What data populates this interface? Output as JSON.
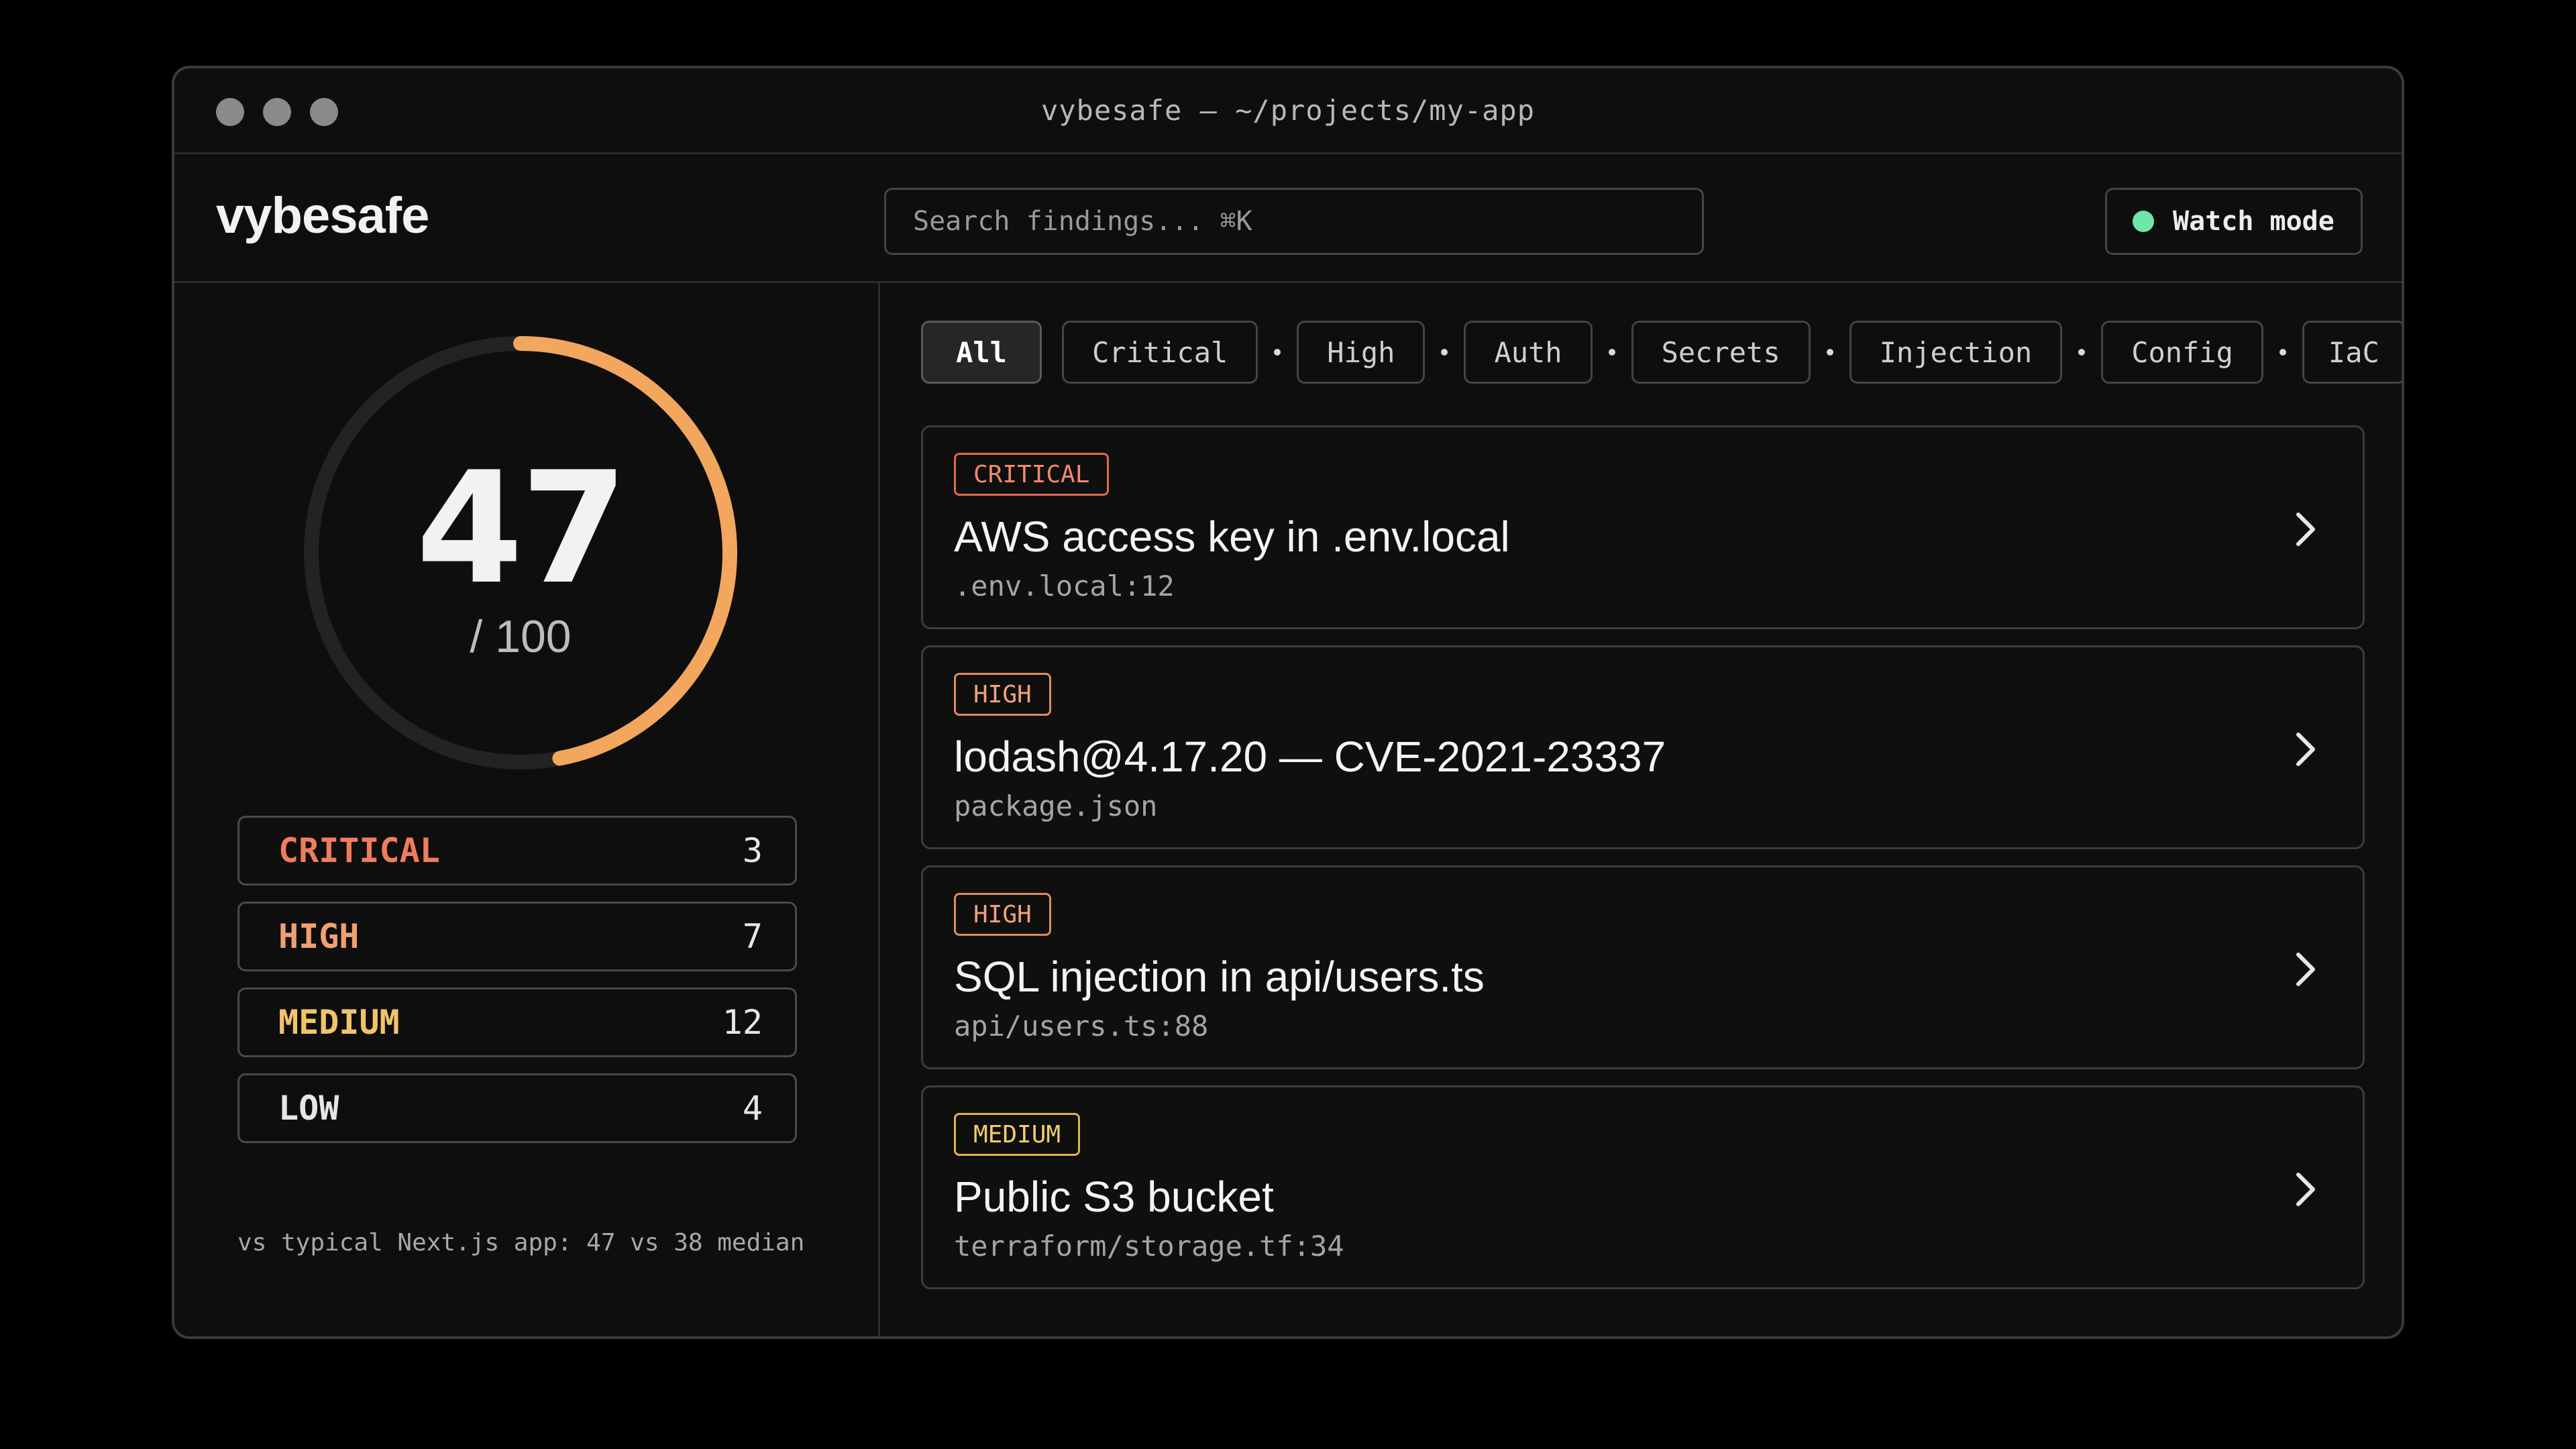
{
  "window": {
    "title": "vybesafe — ~/projects/my-app"
  },
  "header": {
    "brand": "vybesafe",
    "search_placeholder": "Search findings... ⌘K",
    "watch_label": "Watch mode",
    "watch_color": "#6ee7a8"
  },
  "score": {
    "value": "47",
    "out_of": "/ 100",
    "fraction": 0.47,
    "accent": "#f2a65e"
  },
  "severity_counts": [
    {
      "label": "CRITICAL",
      "count": "3",
      "color": "#f07c5c"
    },
    {
      "label": "HIGH",
      "count": "7",
      "color": "#f0a070"
    },
    {
      "label": "MEDIUM",
      "count": "12",
      "color": "#f2c46a"
    },
    {
      "label": "LOW",
      "count": "4",
      "color": "#e6e6e6"
    }
  ],
  "comparison": "vs typical Next.js app: 47 vs 38 median",
  "filters": [
    "All",
    "Critical",
    "High",
    "Auth",
    "Secrets",
    "Injection",
    "Config",
    "IaC"
  ],
  "active_filter": "All",
  "findings": [
    {
      "severity": "CRITICAL",
      "title": "AWS access key in .env.local",
      "path": ".env.local:12"
    },
    {
      "severity": "HIGH",
      "title": "lodash@4.17.20 — CVE-2021-23337",
      "path": "package.json"
    },
    {
      "severity": "HIGH",
      "title": "SQL injection in api/users.ts",
      "path": "api/users.ts:88"
    },
    {
      "severity": "MEDIUM",
      "title": "Public S3 bucket",
      "path": "terraform/storage.tf:34"
    }
  ]
}
